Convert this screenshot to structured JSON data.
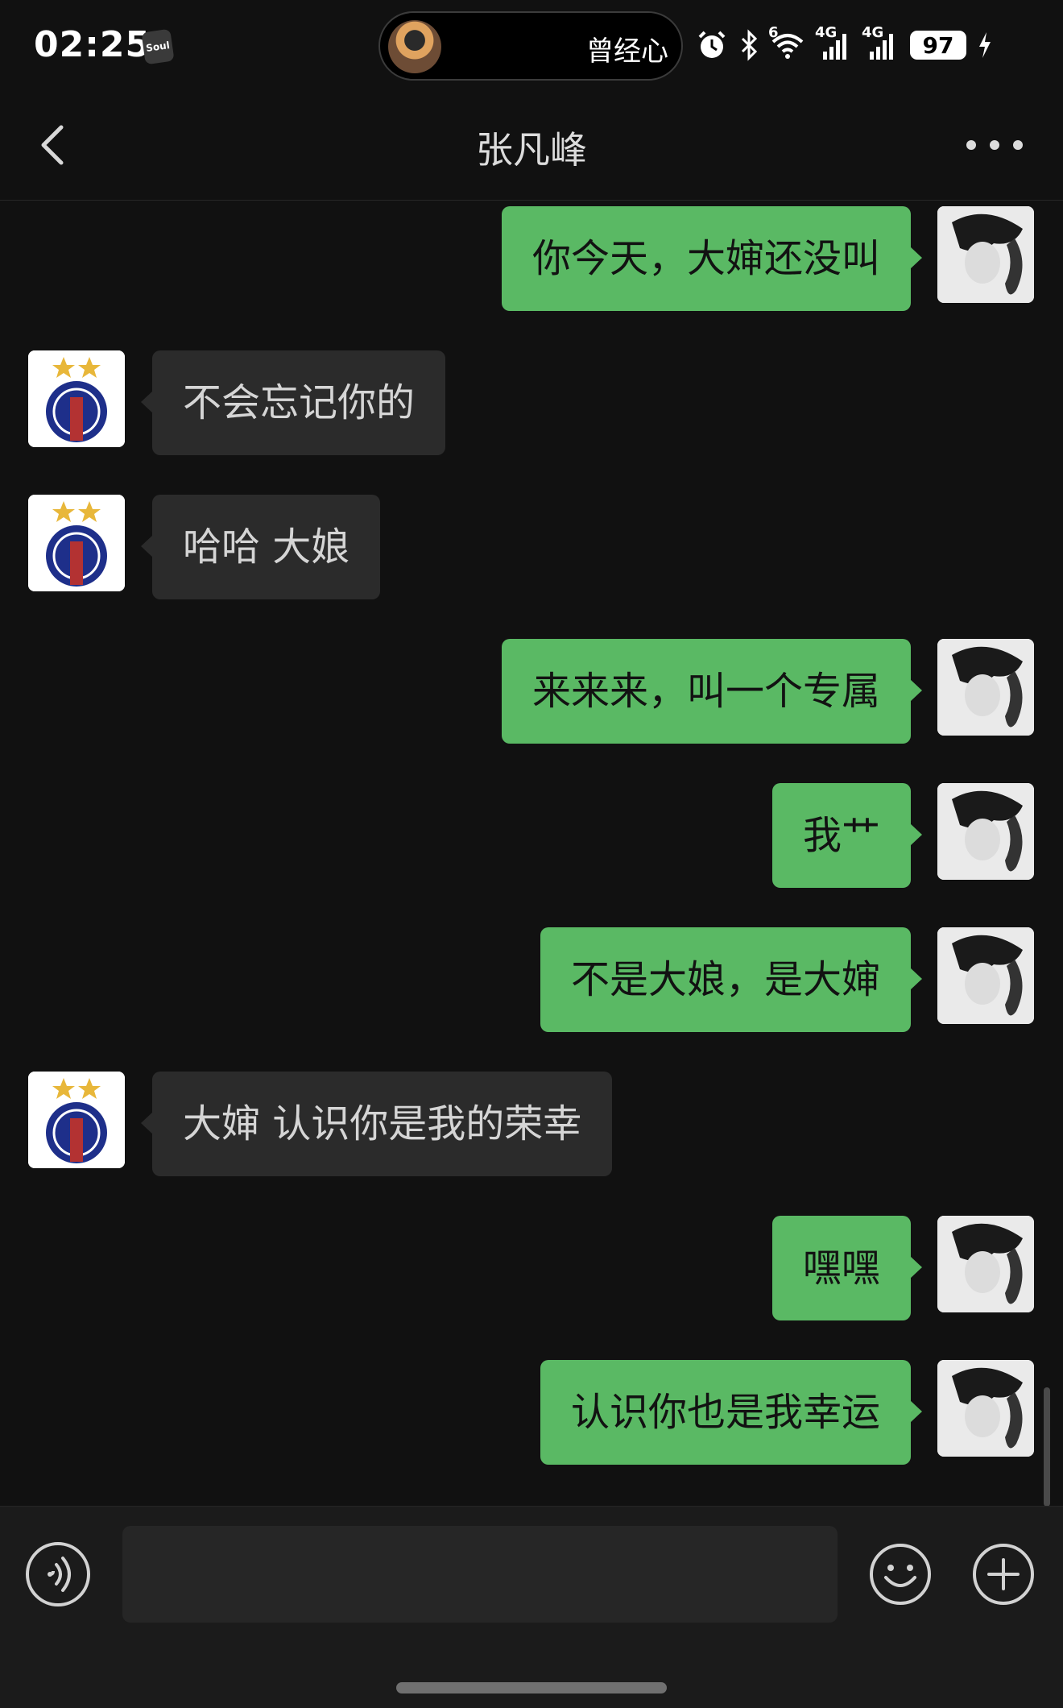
{
  "status_bar": {
    "time": "02:25",
    "app_badge": "Soul",
    "island_text": "曾经心",
    "network_1": "4G",
    "network_2": "4G",
    "wifi_label": "6",
    "battery": "97"
  },
  "header": {
    "title": "张凡峰"
  },
  "messages": [
    {
      "sender": "me",
      "text": "你今天，大婶还没叫"
    },
    {
      "sender": "them",
      "text": "不会忘记你的"
    },
    {
      "sender": "them",
      "text": "哈哈 大娘"
    },
    {
      "sender": "me",
      "text": "来来来，叫一个专属"
    },
    {
      "sender": "me",
      "text": "我艹"
    },
    {
      "sender": "me",
      "text": "不是大娘，是大婶"
    },
    {
      "sender": "them",
      "text": "大婶 认识你是我的荣幸"
    },
    {
      "sender": "me",
      "text": "嘿嘿"
    },
    {
      "sender": "me",
      "text": "认识你也是我幸运"
    }
  ],
  "input": {
    "value": "",
    "placeholder": ""
  },
  "colors": {
    "background": "#111111",
    "my_bubble": "#5ab964",
    "their_bubble": "#2b2b2b",
    "input_bar": "#1b1b1b"
  },
  "icons": {
    "back": "chevron-left-icon",
    "more": "more-dots-icon",
    "voice": "voice-icon",
    "emoji": "emoji-icon",
    "plus": "plus-icon"
  }
}
